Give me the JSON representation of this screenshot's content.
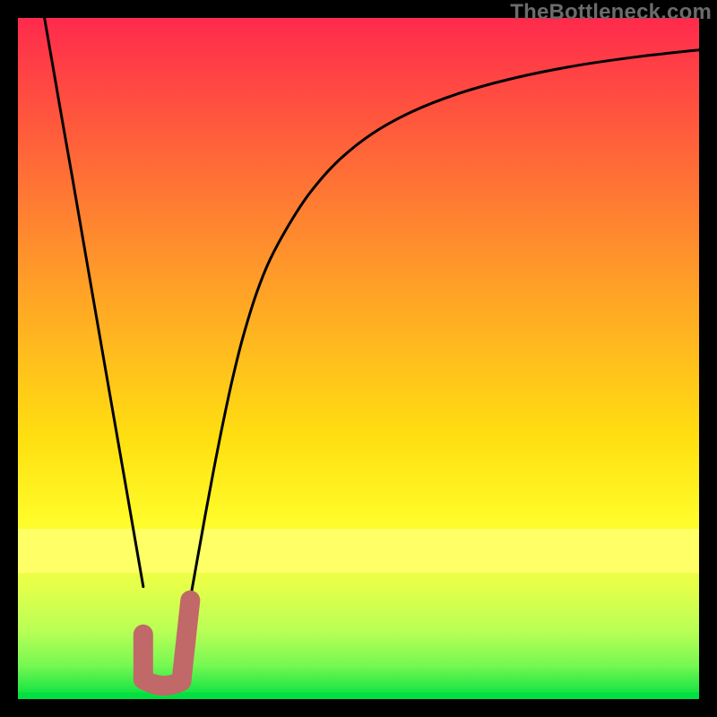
{
  "watermark": {
    "text": "TheBottleneck.com"
  },
  "chart_data": {
    "type": "line",
    "title": "",
    "xlabel": "",
    "ylabel": "",
    "xlim": [
      0,
      100
    ],
    "ylim": [
      0,
      100
    ],
    "grid": false,
    "series": [
      {
        "name": "left-branch",
        "x": [
          3.9,
          6.5,
          8.0,
          10.5,
          13.1,
          15.8,
          18.4
        ],
        "y": [
          100,
          85,
          76.5,
          62,
          47,
          31.5,
          16.5
        ]
      },
      {
        "name": "right-branch",
        "x": [
          25,
          27.5,
          29,
          30.2,
          31.5,
          33,
          35,
          37,
          40,
          43,
          47,
          52,
          58,
          65,
          73,
          82,
          91,
          100
        ],
        "y": [
          13,
          27,
          35,
          41,
          47,
          53,
          59.5,
          64.5,
          70,
          74.5,
          79,
          83,
          86.3,
          89,
          91.2,
          93,
          94.3,
          95.3
        ]
      }
    ],
    "bottom_line": {
      "name": "zero-line",
      "y": 0.6,
      "color": "#00E040"
    },
    "yellow_band": {
      "name": "highlight-band",
      "y_from": 18.5,
      "y_to": 25,
      "color": "#FFFF66"
    },
    "marker": {
      "name": "j-marker",
      "stroke": "#C16868",
      "x1": 18.4,
      "y1": 9.5,
      "xmin": 18.4,
      "ymin": 2.9,
      "xmid": 21.2,
      "ymid": 1.2,
      "x2": 24.0,
      "y2": 2.6,
      "x3": 25.3,
      "y3": 14.5
    },
    "gradient": {
      "stops": [
        {
          "offset": 0.0,
          "color": "#ff2a4d"
        },
        {
          "offset": 0.16,
          "color": "#ff5a3c"
        },
        {
          "offset": 0.32,
          "color": "#ff8a2e"
        },
        {
          "offset": 0.48,
          "color": "#ffb91f"
        },
        {
          "offset": 0.62,
          "color": "#ffe010"
        },
        {
          "offset": 0.74,
          "color": "#fffc2a"
        },
        {
          "offset": 0.83,
          "color": "#e7ff49"
        },
        {
          "offset": 0.9,
          "color": "#b9ff56"
        },
        {
          "offset": 0.95,
          "color": "#78f852"
        },
        {
          "offset": 1.0,
          "color": "#00e040"
        }
      ]
    }
  }
}
